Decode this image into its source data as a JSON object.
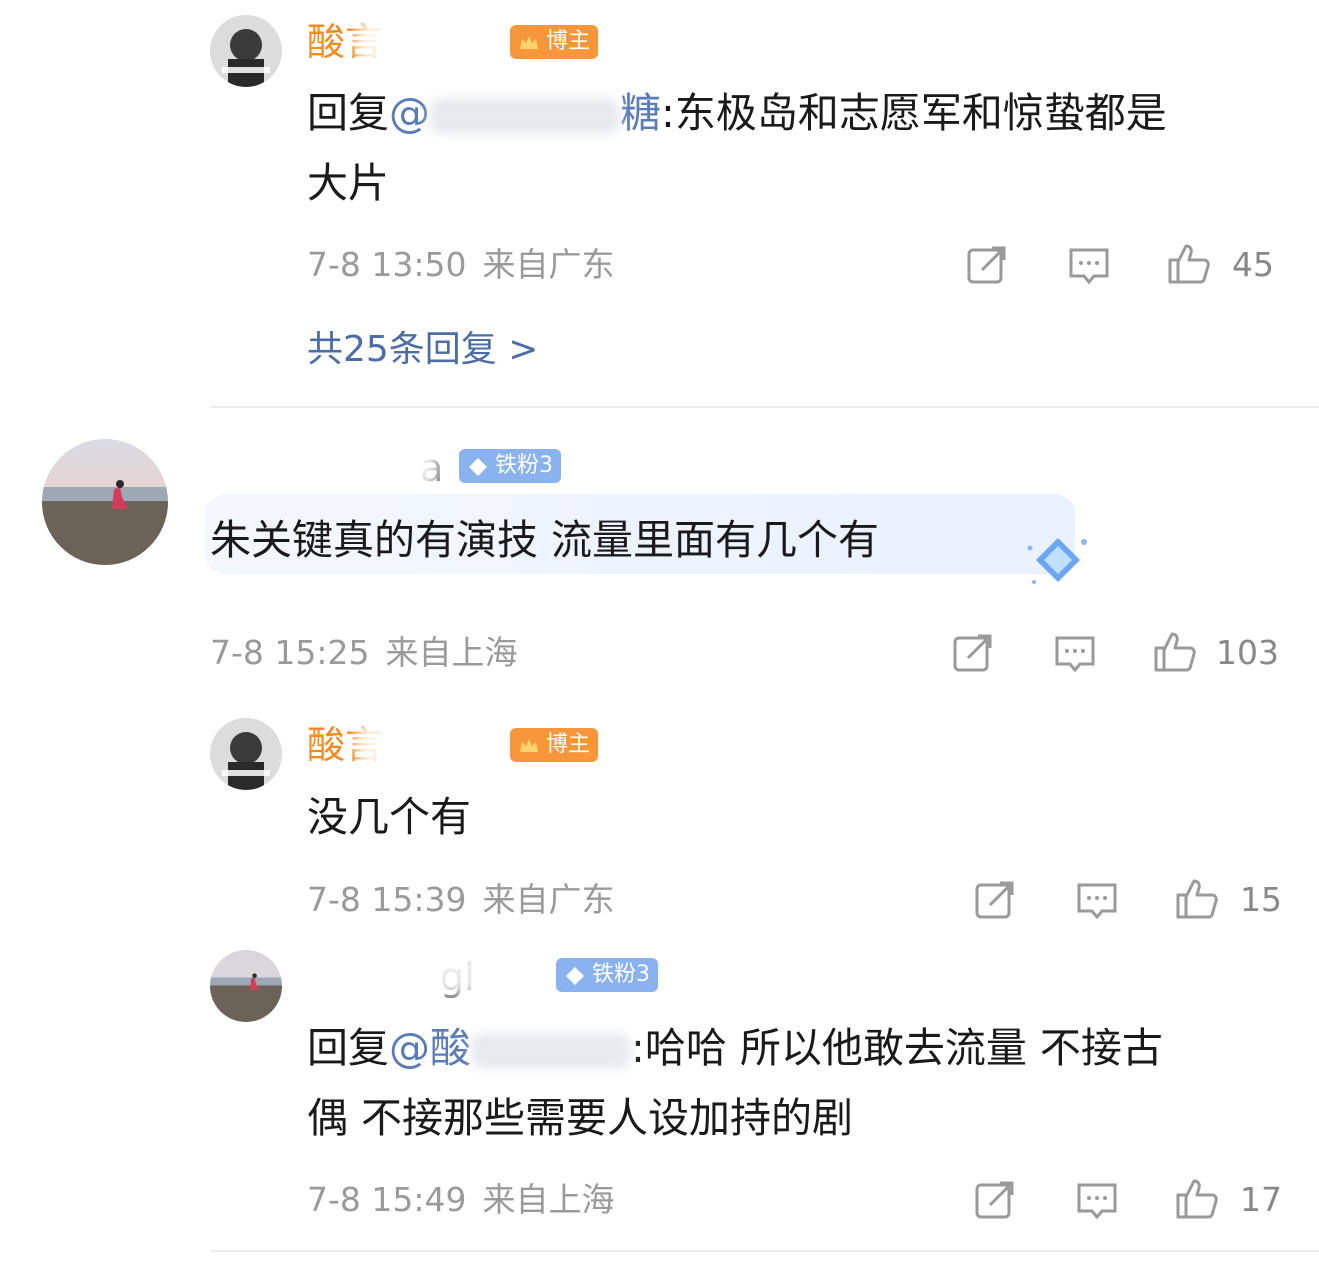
{
  "comments": [
    {
      "name": "酸言",
      "badge": "博主",
      "text_prefix": "回复",
      "mention": "@",
      "mention_tail": "糖",
      "text_body": ":东极岛和志愿军和惊蛰都是",
      "text_line2": "大片",
      "date": "7-8 13:50",
      "location": "来自广东",
      "likes": "45",
      "more_replies": "共25条回复 >"
    },
    {
      "name": "a",
      "badge": "铁粉3",
      "text": "朱关键真的有演技 流量里面有几个有",
      "date": "7-8 15:25",
      "location": "来自上海",
      "likes": "103"
    },
    {
      "name": "酸言",
      "badge": "博主",
      "text": "没几个有",
      "date": "7-8 15:39",
      "location": "来自广东",
      "likes": "15"
    },
    {
      "name": "gl",
      "badge": "铁粉3",
      "text_prefix": "回复",
      "mention": "@酸",
      "text_body": ":哈哈 所以他敢去流量 不接古",
      "text_line2": "偶 不接那些需要人设加持的剧",
      "date": "7-8 15:49",
      "location": "来自上海",
      "likes": "17"
    }
  ],
  "colors": {
    "name_orange": "#f58a1f",
    "mention_blue": "#5a7cb8",
    "badge_orange": "#f7963a",
    "badge_blue": "#8ab2ee",
    "meta_gray": "#9a9a9a"
  },
  "icons": [
    "repost-icon",
    "comment-icon",
    "like-icon",
    "diamond-icon",
    "crown-icon"
  ]
}
